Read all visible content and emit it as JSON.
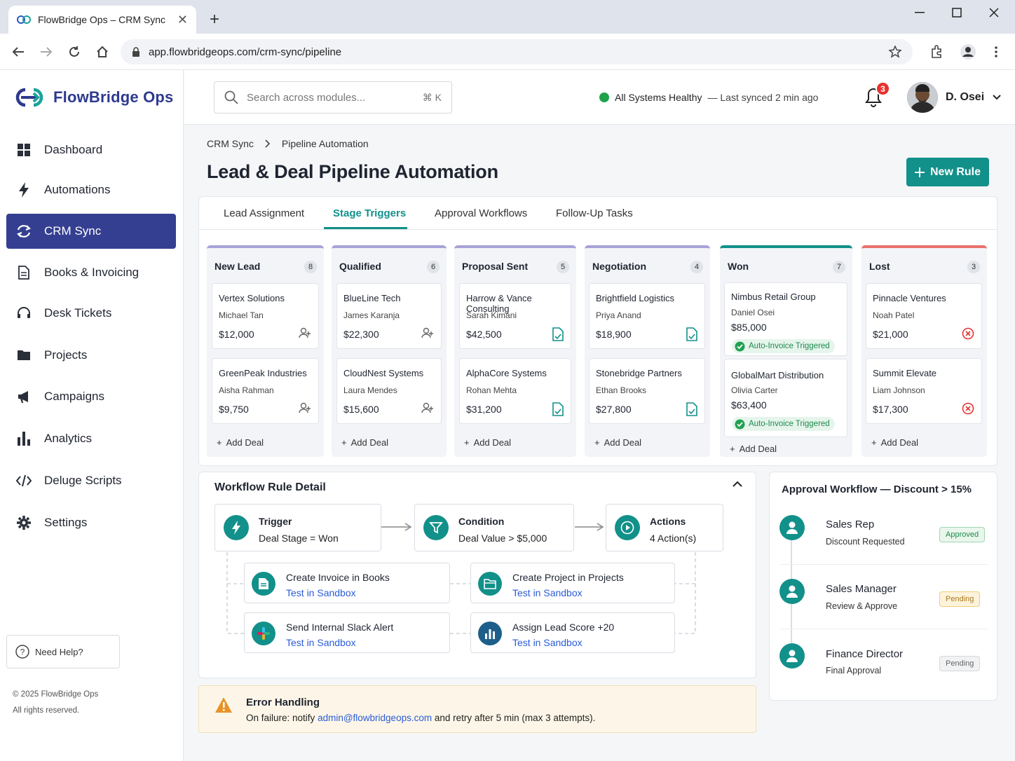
{
  "browser": {
    "tab_title": "FlowBridge Ops – CRM Sync",
    "url": "app.flowbridgeops.com/crm-sync/pipeline"
  },
  "brand": {
    "name": "FlowBridge Ops"
  },
  "sidebar": {
    "items": [
      {
        "label": "Dashboard",
        "icon": "grid-icon"
      },
      {
        "label": "Automations",
        "icon": "bolt-icon"
      },
      {
        "label": "CRM Sync",
        "icon": "sync-icon",
        "active": true
      },
      {
        "label": "Books & Invoicing",
        "icon": "document-icon"
      },
      {
        "label": "Desk Tickets",
        "icon": "headset-icon"
      },
      {
        "label": "Projects",
        "icon": "folder-icon"
      },
      {
        "label": "Campaigns",
        "icon": "megaphone-icon"
      },
      {
        "label": "Analytics",
        "icon": "bar-chart-icon"
      },
      {
        "label": "Deluge Scripts",
        "icon": "code-icon"
      },
      {
        "label": "Settings",
        "icon": "gear-icon"
      }
    ],
    "help_label": "Need Help?",
    "copyright": "© 2025 FlowBridge Ops",
    "rights": "All rights reserved."
  },
  "header": {
    "search_placeholder": "Search across modules...",
    "search_shortcut": "⌘ K",
    "status_label": "All Systems Healthy",
    "status_sync": "— Last synced 2 min ago",
    "notifications": "3",
    "user_name": "D. Osei"
  },
  "breadcrumb": [
    "CRM Sync",
    "Pipeline Automation"
  ],
  "page_title": "Lead & Deal Pipeline Automation",
  "new_rule_label": "New Rule",
  "tabs": [
    "Lead Assignment",
    "Stage Triggers",
    "Approval Workflows",
    "Follow-Up Tasks"
  ],
  "active_tab": "Stage Triggers",
  "add_deal_label": "Add Deal",
  "columns": [
    {
      "name": "New Lead",
      "count": "8",
      "accent": "#a7a2d8",
      "cards": [
        {
          "company": "Vertex Solutions",
          "person": "Michael Tan",
          "value": "$12,000",
          "icon": "assign-user-icon"
        },
        {
          "company": "GreenPeak Industries",
          "person": "Aisha Rahman",
          "value": "$9,750",
          "icon": "assign-user-icon"
        }
      ]
    },
    {
      "name": "Qualified",
      "count": "6",
      "accent": "#a7a2d8",
      "cards": [
        {
          "company": "BlueLine Tech",
          "person": "James Karanja",
          "value": "$22,300",
          "icon": "assign-user-icon"
        },
        {
          "company": "CloudNest Systems",
          "person": "Laura Mendes",
          "value": "$15,600",
          "icon": "assign-user-icon"
        }
      ]
    },
    {
      "name": "Proposal Sent",
      "count": "5",
      "accent": "#a7a2d8",
      "cards": [
        {
          "company": "Harrow & Vance Consulting",
          "person": "Sarah Kimani",
          "value": "$42,500",
          "icon": "invoice-doc-icon"
        },
        {
          "company": "AlphaCore Systems",
          "person": "Rohan Mehta",
          "value": "$31,200",
          "icon": "invoice-doc-icon"
        }
      ]
    },
    {
      "name": "Negotiation",
      "count": "4",
      "accent": "#a7a2d8",
      "cards": [
        {
          "company": "Brightfield Logistics",
          "person": "Priya Anand",
          "value": "$18,900",
          "icon": "invoice-doc-icon"
        },
        {
          "company": "Stonebridge Partners",
          "person": "Ethan Brooks",
          "value": "$27,800",
          "icon": "invoice-doc-icon"
        }
      ]
    },
    {
      "name": "Won",
      "count": "7",
      "accent": "#12908a",
      "cards": [
        {
          "company": "Nimbus Retail Group",
          "person": "Daniel Osei",
          "value": "$85,000",
          "tag": "Auto-Invoice Triggered"
        },
        {
          "company": "GlobalMart Distribution",
          "person": "Olivia Carter",
          "value": "$63,400",
          "tag": "Auto-Invoice Triggered"
        }
      ]
    },
    {
      "name": "Lost",
      "count": "3",
      "accent": "#e8716d",
      "cards": [
        {
          "company": "Pinnacle Ventures",
          "person": "Noah Patel",
          "value": "$21,000",
          "icon": "lost-x-icon"
        },
        {
          "company": "Summit Elevate",
          "person": "Liam Johnson",
          "value": "$17,300",
          "icon": "lost-x-icon"
        }
      ]
    }
  ],
  "workflow": {
    "title": "Workflow Rule Detail",
    "trigger": {
      "title": "Trigger",
      "sub": "Deal Stage = Won"
    },
    "condition": {
      "title": "Condition",
      "sub": "Deal Value > $5,000"
    },
    "actions": {
      "title": "Actions",
      "sub": "4 Action(s)"
    },
    "action_list": [
      {
        "title": "Create Invoice in Books",
        "link": "Test in Sandbox",
        "icon": "invoice-icon"
      },
      {
        "title": "Create Project in Projects",
        "link": "Test in Sandbox",
        "icon": "folder-icon"
      },
      {
        "title": "Send Internal Slack Alert",
        "link": "Test in Sandbox",
        "icon": "slack-icon"
      },
      {
        "title": "Assign Lead Score +20",
        "link": "Test in Sandbox",
        "icon": "bar-chart-icon"
      }
    ]
  },
  "error_handling": {
    "title": "Error Handling",
    "text_before": "On failure: notify ",
    "email": "admin@flowbridgeops.com",
    "text_after": " and retry after 5 min (max 3 attempts)."
  },
  "approval": {
    "title": "Approval Workflow — Discount > 15%",
    "steps": [
      {
        "role": "Sales Rep",
        "task": "Discount Requested",
        "status": "Approved"
      },
      {
        "role": "Sales Manager",
        "task": "Review & Approve",
        "status": "Pending"
      },
      {
        "role": "Finance Director",
        "task": "Final Approval",
        "status": "Pending"
      }
    ]
  },
  "colors": {
    "brand": "#353f91",
    "accent": "#12908a",
    "lost": "#e5322f",
    "link": "#2a5bd7"
  }
}
